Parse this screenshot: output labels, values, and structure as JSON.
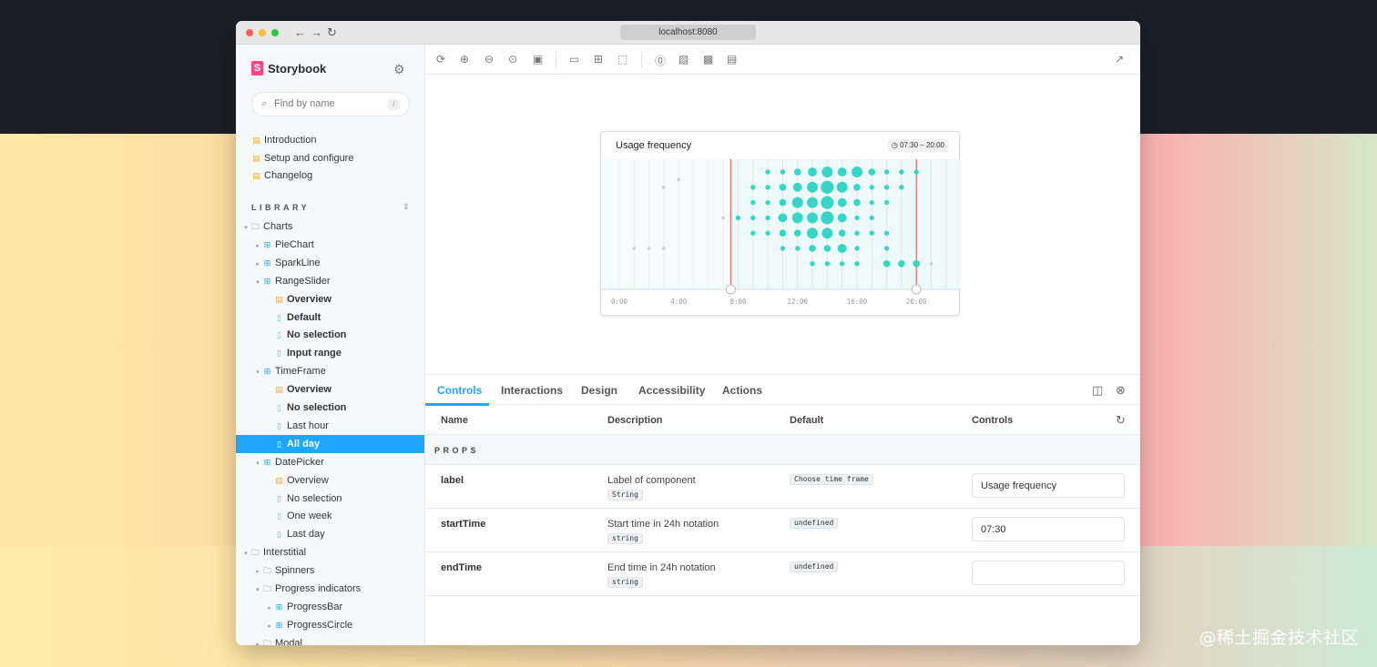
{
  "browser": {
    "url": "localhost:8080"
  },
  "sidebar": {
    "brand": "Storybook",
    "search_placeholder": "Find by name",
    "search_shortcut": "/",
    "docs": [
      {
        "label": "Introduction"
      },
      {
        "label": "Setup and configure"
      },
      {
        "label": "Changelog"
      }
    ],
    "library_heading": "LIBRARY",
    "tree": [
      {
        "label": "Charts",
        "type": "folder",
        "depth": 0,
        "expanded": true
      },
      {
        "label": "PieChart",
        "type": "component",
        "depth": 1,
        "expanded": false
      },
      {
        "label": "SparkLine",
        "type": "component",
        "depth": 1,
        "expanded": false
      },
      {
        "label": "RangeSlider",
        "type": "component",
        "depth": 1,
        "expanded": true
      },
      {
        "label": "Overview",
        "type": "doc",
        "depth": 2,
        "bold": true
      },
      {
        "label": "Default",
        "type": "story",
        "depth": 2,
        "bold": true
      },
      {
        "label": "No selection",
        "type": "story",
        "depth": 2,
        "bold": true
      },
      {
        "label": "Input range",
        "type": "story",
        "depth": 2,
        "bold": true
      },
      {
        "label": "TimeFrame",
        "type": "component",
        "depth": 1,
        "expanded": true
      },
      {
        "label": "Overview",
        "type": "doc",
        "depth": 2,
        "bold": true
      },
      {
        "label": "No selection",
        "type": "story",
        "depth": 2,
        "bold": true
      },
      {
        "label": "Last hour",
        "type": "story",
        "depth": 2
      },
      {
        "label": "All day",
        "type": "story",
        "depth": 2,
        "selected": true
      },
      {
        "label": "DatePicker",
        "type": "component",
        "depth": 1,
        "expanded": true
      },
      {
        "label": "Overview",
        "type": "doc",
        "depth": 2
      },
      {
        "label": "No selection",
        "type": "story",
        "depth": 2
      },
      {
        "label": "One week",
        "type": "story",
        "depth": 2
      },
      {
        "label": "Last day",
        "type": "story",
        "depth": 2
      },
      {
        "label": "Interstitial",
        "type": "folder",
        "depth": 0,
        "expanded": true
      },
      {
        "label": "Spinners",
        "type": "folder",
        "depth": 1,
        "expanded": false
      },
      {
        "label": "Progress indicators",
        "type": "folder",
        "depth": 1,
        "expanded": true
      },
      {
        "label": "ProgressBar",
        "type": "component",
        "depth": 2,
        "expanded": false
      },
      {
        "label": "ProgressCircle",
        "type": "component",
        "depth": 2,
        "expanded": false
      },
      {
        "label": "Modal",
        "type": "folder",
        "depth": 1,
        "expanded": false
      }
    ]
  },
  "preview": {
    "title": "Usage frequency",
    "badge": "07:30 – 20:00"
  },
  "chart_data": {
    "type": "scatter",
    "title": "Usage frequency",
    "x_ticks": [
      "0:00",
      "4:00",
      "8:00",
      "12:00",
      "16:00",
      "20:00"
    ],
    "xlim": [
      0,
      22.5
    ],
    "rows": 7,
    "selection": [
      7.5,
      20
    ],
    "colors": {
      "active": "#37d5c5",
      "inactive": "#c8cccf",
      "handle": "#e06b6b",
      "band": "#eefafa"
    },
    "points": [
      [
        1,
        5,
        1
      ],
      [
        2,
        5,
        1
      ],
      [
        3,
        1,
        1
      ],
      [
        3,
        5,
        1
      ],
      [
        4,
        0.5,
        1
      ],
      [
        7,
        3,
        1
      ],
      [
        8,
        3,
        1
      ],
      [
        9,
        1,
        1
      ],
      [
        9,
        2,
        1
      ],
      [
        9,
        3,
        1
      ],
      [
        9,
        4,
        1
      ],
      [
        10,
        0,
        1
      ],
      [
        10,
        1,
        1
      ],
      [
        10,
        2,
        1
      ],
      [
        10,
        3,
        1
      ],
      [
        10,
        4,
        1
      ],
      [
        11,
        0,
        1
      ],
      [
        11,
        1,
        2
      ],
      [
        11,
        2,
        2
      ],
      [
        11,
        3,
        3
      ],
      [
        11,
        4,
        2
      ],
      [
        11,
        5,
        1
      ],
      [
        12,
        0,
        2
      ],
      [
        12,
        1,
        3
      ],
      [
        12,
        2,
        4
      ],
      [
        12,
        3,
        4
      ],
      [
        12,
        4,
        2
      ],
      [
        12,
        5,
        1
      ],
      [
        13,
        0,
        3
      ],
      [
        13,
        1,
        4
      ],
      [
        13,
        2,
        4
      ],
      [
        13,
        3,
        4
      ],
      [
        13,
        4,
        4
      ],
      [
        13,
        5,
        2
      ],
      [
        13,
        6,
        1
      ],
      [
        14,
        0,
        4
      ],
      [
        14,
        1,
        5
      ],
      [
        14,
        2,
        5
      ],
      [
        14,
        3,
        5
      ],
      [
        14,
        4,
        4
      ],
      [
        14,
        5,
        2
      ],
      [
        14,
        6,
        1
      ],
      [
        15,
        0,
        3
      ],
      [
        15,
        1,
        4
      ],
      [
        15,
        2,
        3
      ],
      [
        15,
        3,
        3
      ],
      [
        15,
        4,
        2
      ],
      [
        15,
        5,
        3
      ],
      [
        15,
        6,
        1
      ],
      [
        16,
        0,
        4
      ],
      [
        16,
        1,
        2
      ],
      [
        16,
        2,
        2
      ],
      [
        16,
        3,
        1
      ],
      [
        16,
        4,
        1
      ],
      [
        16,
        5,
        1
      ],
      [
        16,
        6,
        1
      ],
      [
        17,
        0,
        2
      ],
      [
        17,
        1,
        1
      ],
      [
        17,
        2,
        1
      ],
      [
        17,
        3,
        1
      ],
      [
        17,
        4,
        1
      ],
      [
        18,
        0,
        1
      ],
      [
        18,
        1,
        1
      ],
      [
        18,
        2,
        1
      ],
      [
        18,
        4,
        1
      ],
      [
        18,
        5,
        1
      ],
      [
        18,
        6,
        2
      ],
      [
        19,
        0,
        1
      ],
      [
        19,
        1,
        1
      ],
      [
        19,
        6,
        2
      ],
      [
        20,
        0,
        1
      ],
      [
        20,
        6,
        2
      ],
      [
        21,
        6,
        1
      ]
    ]
  },
  "panel": {
    "tabs": [
      "Controls",
      "Interactions",
      "Design",
      "Accessibility",
      "Actions"
    ],
    "active_tab": "Controls",
    "headers": {
      "name": "Name",
      "description": "Description",
      "default": "Default",
      "controls": "Controls"
    },
    "section": "PROPS",
    "rows": [
      {
        "name": "label",
        "description": "Label of component",
        "type": "String",
        "default": "Choose time frame",
        "value": ""
      },
      {
        "name": "startTime",
        "description": "Start time in 24h notation",
        "type": "string",
        "default": "undefined",
        "value": "07:30"
      },
      {
        "name": "endTime",
        "description": "End time in 24h notation",
        "type": "string",
        "default": "undefined",
        "value": ""
      }
    ],
    "label_value": "Usage frequency"
  },
  "watermark": "@稀土掘金技术社区"
}
